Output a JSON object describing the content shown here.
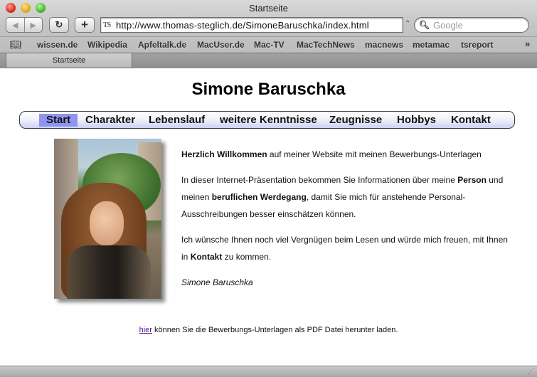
{
  "window": {
    "title": "Startseite"
  },
  "toolbar": {
    "back_glyph": "◀",
    "forward_glyph": "▶",
    "reload_glyph": "↻",
    "add_glyph": "+",
    "favicon_text": "TS",
    "url": "http://www.thomas-steglich.de/SimoneBaruschka/index.html",
    "search_placeholder": "Google"
  },
  "bookmarks": {
    "items": [
      "wissen.de",
      "Wikipedia",
      "Apfeltalk.de",
      "MacUser.de",
      "Mac-TV",
      "MacTechNews",
      "macnews",
      "metamac",
      "tsreport"
    ],
    "more_glyph": "»"
  },
  "tabs": [
    {
      "label": "Startseite"
    }
  ],
  "page": {
    "title": "Simone Baruschka",
    "menu": [
      "Start",
      "Charakter",
      "Lebenslauf",
      "weitere Kenntnisse",
      "Zeugnisse",
      "Hobbys",
      "Kontakt"
    ],
    "active_menu": "Start",
    "intro": {
      "p1_bold": "Herzlich Willkommen",
      "p1_rest": " auf meiner Website mit meinen Bewerbungs-Unterlagen",
      "p2_a": "In dieser Internet-Präsentation bekommen Sie Informationen über meine ",
      "p2_bold1": "Person",
      "p2_b": " und meinen ",
      "p2_bold2": "beruflichen Werdegang",
      "p2_c": ", damit Sie mich für anstehende Personal-Ausschreibungen besser einschätzen können.",
      "p3_a": "Ich wünsche Ihnen noch viel Vergnügen beim Lesen und würde mich freuen, mit Ihnen in ",
      "p3_bold": "Kontakt",
      "p3_b": " zu kommen.",
      "signature": "Simone Baruschka"
    },
    "footer": {
      "link": "hier",
      "text": " können Sie die Bewerbungs-Unterlagen als PDF Datei herunter laden."
    }
  }
}
